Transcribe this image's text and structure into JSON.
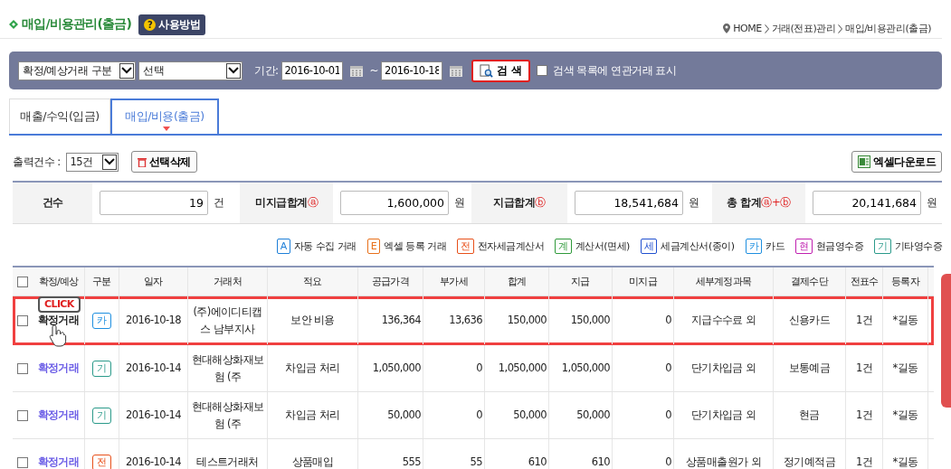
{
  "page": {
    "title": "매입/비용관리(출금)",
    "help_icon": "?",
    "help_button": "사용방법",
    "breadcrumb": [
      "HOME",
      "거래(전표)관리",
      "매입/비용관리(출금)"
    ]
  },
  "search_bar": {
    "type_select": "확정/예상거래 구분",
    "option_select": "선택",
    "period_label": "기간:",
    "date_from": "2016-10-01",
    "tilde": "~",
    "date_to": "2016-10-18",
    "search_button": "검 색",
    "related_checkbox": {
      "label": "검색 목록에 연관거래 표시",
      "checked": false
    }
  },
  "tabs": [
    {
      "label": "매출/수익(입금)",
      "selected": false
    },
    {
      "label": "매입/비용(출금)",
      "selected": true
    }
  ],
  "toolbar": {
    "page_size_label": "출력건수 :",
    "page_size": "15건",
    "delete_button": "선택삭제",
    "excel_button": "엑셀다운로드"
  },
  "summary": [
    {
      "label": "건수",
      "value": "19",
      "unit": "건"
    },
    {
      "label": "미지급합계",
      "mark": "ⓐ",
      "value": "1,600,000",
      "unit": "원"
    },
    {
      "label": "지급합계",
      "mark": "ⓑ",
      "value": "18,541,684",
      "unit": "원"
    },
    {
      "label": "총 합계",
      "mark": "ⓐ+ⓑ",
      "value": "20,141,684",
      "unit": "원"
    }
  ],
  "legend": [
    {
      "badge": "A",
      "label": "자동 수집 거래",
      "color": "#1e7fd8"
    },
    {
      "badge": "E",
      "label": "엑셀 등록 거래",
      "color": "#e8701a"
    },
    {
      "badge": "전",
      "label": "전자세금계산서",
      "color": "#e8501a"
    },
    {
      "badge": "계",
      "label": "계산서(면세)",
      "color": "#2f9a3a"
    },
    {
      "badge": "세",
      "label": "세금계산서(종이)",
      "color": "#2050d0"
    },
    {
      "badge": "카",
      "label": "카드",
      "color": "#1e8fe0"
    },
    {
      "badge": "현",
      "label": "현금영수증",
      "color": "#c020b0"
    },
    {
      "badge": "기",
      "label": "기타영수증",
      "color": "#2a9a8a"
    }
  ],
  "table": {
    "columns": [
      "확정/예상",
      "구분",
      "일자",
      "거래처",
      "적요",
      "공급가격",
      "부가세",
      "합계",
      "지급",
      "미지급",
      "세부계정과목",
      "결제수단",
      "전표수",
      "등록자"
    ],
    "header_checkbox": {
      "checked": false
    },
    "rows": [
      {
        "checked": false,
        "highlighted": true,
        "status": "확정거래",
        "type": "카",
        "color": "#1e8fe0",
        "date": "2016-10-18",
        "partner": "(주)에이디티캡스 남부지사",
        "memo": "보안 비용",
        "supply": "136,364",
        "vat": "13,636",
        "total": "150,000",
        "paid": "150,000",
        "unpaid": "0",
        "account": "지급수수료 외",
        "payment": "신용카드",
        "slips": "1건",
        "registrant": "*길동",
        "callout": "CLICK"
      },
      {
        "checked": false,
        "highlighted": false,
        "status": "확정거래",
        "type": "기",
        "color": "#2a9a8a",
        "date": "2016-10-14",
        "partner": "현대해상화재보험 (주",
        "memo": "차입금 처리",
        "supply": "1,050,000",
        "vat": "0",
        "total": "1,050,000",
        "paid": "1,050,000",
        "unpaid": "0",
        "account": "단기차입금 외",
        "payment": "보통예금",
        "slips": "1건",
        "registrant": "*길동"
      },
      {
        "checked": false,
        "highlighted": false,
        "status": "확정거래",
        "type": "기",
        "color": "#2a9a8a",
        "date": "2016-10-14",
        "partner": "현대해상화재보험 (주",
        "memo": "차입금 처리",
        "supply": "50,000",
        "vat": "0",
        "total": "50,000",
        "paid": "50,000",
        "unpaid": "0",
        "account": "단기차입금 외",
        "payment": "현금",
        "slips": "1건",
        "registrant": "*길동"
      },
      {
        "checked": false,
        "highlighted": false,
        "status": "확정거래",
        "type": "전",
        "color": "#e8501a",
        "date": "2016-10-14",
        "partner": "테스트거래처",
        "memo": "상품매입",
        "supply": "555",
        "vat": "55",
        "total": "610",
        "paid": "610",
        "unpaid": "0",
        "account": "상품매출원가 외",
        "payment": "정기예적금",
        "slips": "1건",
        "registrant": "*길동"
      }
    ]
  }
}
